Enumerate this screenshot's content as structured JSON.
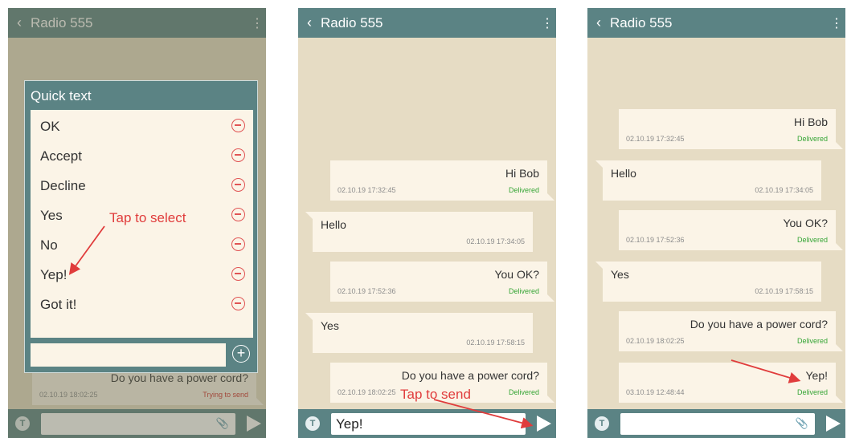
{
  "app": {
    "title": "Radio 555",
    "back_icon": "chevron-left-icon",
    "menu_icon": "more-vertical-icon"
  },
  "colors": {
    "appbar": "#5b8384",
    "background": "#e6dcc4",
    "bubble": "#fbf4e7",
    "delivered": "#35a535",
    "error": "#d0302b",
    "annotation": "#e03c3c"
  },
  "screen1": {
    "dialog": {
      "title": "Quick text",
      "items": [
        "OK",
        "Accept",
        "Decline",
        "Yes",
        "No",
        "Yep!",
        "Got it!"
      ],
      "input_value": "",
      "add_icon": "plus-circle-icon"
    },
    "bg_message": {
      "text": "Do you have a power cord?",
      "timestamp": "02.10.19 18:02:25",
      "status": "Trying to send"
    },
    "annotation": "Tap to select",
    "composer": {
      "value": ""
    }
  },
  "screen2": {
    "messages": [
      {
        "dir": "out",
        "text": "Hi Bob",
        "timestamp": "02.10.19 17:32:45",
        "status": "Delivered"
      },
      {
        "dir": "in",
        "text": "Hello",
        "timestamp": "02.10.19 17:34:05"
      },
      {
        "dir": "out",
        "text": "You OK?",
        "timestamp": "02.10.19 17:52:36",
        "status": "Delivered"
      },
      {
        "dir": "in",
        "text": "Yes",
        "timestamp": "02.10.19 17:58:15"
      },
      {
        "dir": "out",
        "text": "Do you have a power cord?",
        "timestamp": "02.10.19 18:02:25",
        "status": "Delivered"
      }
    ],
    "annotation": "Tap to send",
    "composer": {
      "value": "Yep!"
    }
  },
  "screen3": {
    "messages": [
      {
        "dir": "out",
        "text": "Hi Bob",
        "timestamp": "02.10.19 17:32:45",
        "status": "Delivered"
      },
      {
        "dir": "in",
        "text": "Hello",
        "timestamp": "02.10.19 17:34:05"
      },
      {
        "dir": "out",
        "text": "You OK?",
        "timestamp": "02.10.19 17:52:36",
        "status": "Delivered"
      },
      {
        "dir": "in",
        "text": "Yes",
        "timestamp": "02.10.19 17:58:15"
      },
      {
        "dir": "out",
        "text": "Do you have a power cord?",
        "timestamp": "02.10.19 18:02:25",
        "status": "Delivered"
      },
      {
        "dir": "out",
        "text": "Yep!",
        "timestamp": "03.10.19 12:48:44",
        "status": "Delivered"
      }
    ],
    "composer": {
      "value": ""
    }
  }
}
